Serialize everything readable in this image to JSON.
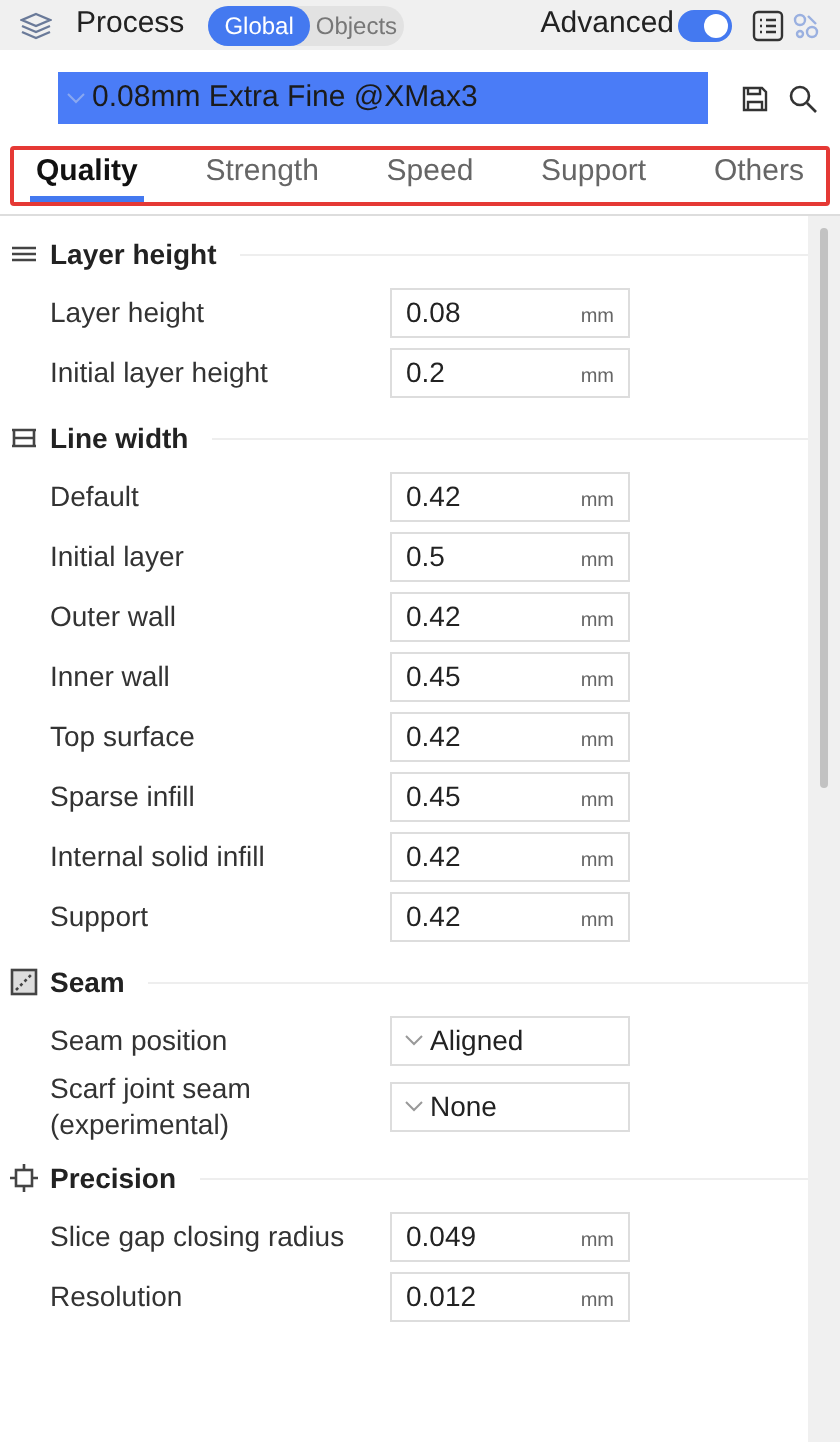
{
  "header": {
    "title": "Process",
    "scope_toggle": [
      {
        "label": "Global",
        "selected": true
      },
      {
        "label": "Objects",
        "selected": false
      }
    ],
    "advanced": {
      "label": "Advanced",
      "on": true
    }
  },
  "preset": {
    "value": "0.08mm Extra Fine @XMax3"
  },
  "tabs": [
    {
      "label": "Quality",
      "selected": true
    },
    {
      "label": "Strength",
      "selected": false
    },
    {
      "label": "Speed",
      "selected": false
    },
    {
      "label": "Support",
      "selected": false
    },
    {
      "label": "Others",
      "selected": false
    }
  ],
  "sections": [
    {
      "title": "Layer height",
      "kind": "layers",
      "rows": [
        {
          "kind": "input",
          "label": "Layer height",
          "value": "0.08",
          "unit": "mm"
        },
        {
          "kind": "input",
          "label": "Initial layer height",
          "value": "0.2",
          "unit": "mm"
        }
      ]
    },
    {
      "title": "Line width",
      "kind": "width",
      "rows": [
        {
          "kind": "input",
          "label": "Default",
          "value": "0.42",
          "unit": "mm"
        },
        {
          "kind": "input",
          "label": "Initial layer",
          "value": "0.5",
          "unit": "mm"
        },
        {
          "kind": "input",
          "label": "Outer wall",
          "value": "0.42",
          "unit": "mm"
        },
        {
          "kind": "input",
          "label": "Inner wall",
          "value": "0.45",
          "unit": "mm"
        },
        {
          "kind": "input",
          "label": "Top surface",
          "value": "0.42",
          "unit": "mm"
        },
        {
          "kind": "input",
          "label": "Sparse infill",
          "value": "0.45",
          "unit": "mm"
        },
        {
          "kind": "input",
          "label": "Internal solid infill",
          "value": "0.42",
          "unit": "mm"
        },
        {
          "kind": "input",
          "label": "Support",
          "value": "0.42",
          "unit": "mm"
        }
      ]
    },
    {
      "title": "Seam",
      "kind": "seam",
      "rows": [
        {
          "kind": "dropdown",
          "label": "Seam position",
          "value": "Aligned"
        },
        {
          "kind": "dropdown",
          "label": "Scarf joint seam (experimental)",
          "value": "None"
        }
      ]
    },
    {
      "title": "Precision",
      "kind": "precision",
      "rows": [
        {
          "kind": "input",
          "label": "Slice gap closing radius",
          "value": "0.049",
          "unit": "mm"
        },
        {
          "kind": "input",
          "label": "Resolution",
          "value": "0.012",
          "unit": "mm"
        }
      ]
    }
  ]
}
